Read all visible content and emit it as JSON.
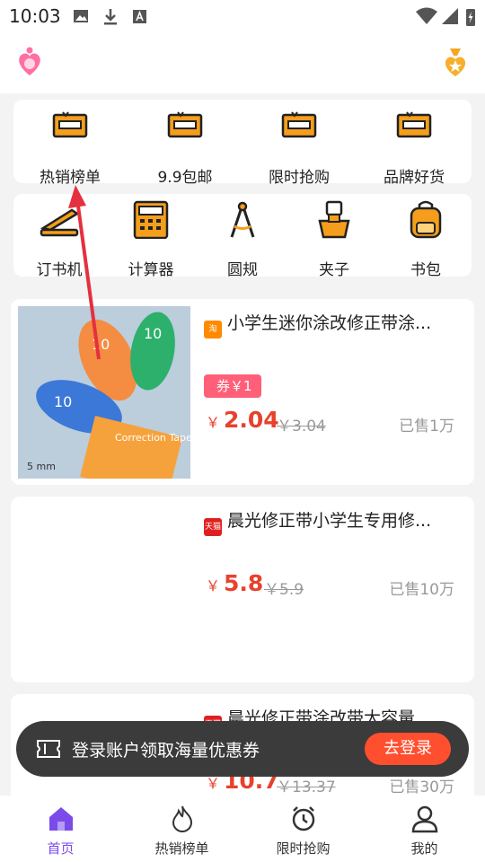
{
  "status_bar": {
    "time": "10:03"
  },
  "top_categories": [
    {
      "label": "热销榜单",
      "icon": "ticket-icon"
    },
    {
      "label": "9.9包邮",
      "icon": "ticket-icon"
    },
    {
      "label": "限时抢购",
      "icon": "ticket-icon"
    },
    {
      "label": "品牌好货",
      "icon": "ticket-icon"
    }
  ],
  "sub_categories": [
    {
      "label": "订书机",
      "icon": "stapler-icon"
    },
    {
      "label": "计算器",
      "icon": "calculator-icon"
    },
    {
      "label": "圆规",
      "icon": "compass-icon"
    },
    {
      "label": "夹子",
      "icon": "clip-icon"
    },
    {
      "label": "书包",
      "icon": "backpack-icon"
    }
  ],
  "products": [
    {
      "title": "小学生迷你涂改修正带涂...",
      "shop": "淘",
      "coupon": "券￥1",
      "yen": "￥",
      "price": "2.04",
      "orig_price": "￥3.04",
      "sold": "已售1万",
      "image_text": [
        "10",
        "10",
        "10",
        "Correction Tape",
        "5 mm"
      ]
    },
    {
      "title": "晨光修正带小学生专用修...",
      "shop": "天猫",
      "yen": "￥",
      "price": "5.8",
      "orig_price": "￥5.9",
      "sold": "已售10万"
    },
    {
      "title": "晨光修正带涂改带大容量...",
      "shop": "天猫",
      "yen": "￥",
      "price": "10.7",
      "orig_price": "￥13.37",
      "sold": "已售30万"
    }
  ],
  "toast": {
    "message": "登录账户领取海量优惠券",
    "button": "去登录"
  },
  "tabbar": [
    {
      "label": "首页",
      "icon": "home-icon",
      "active": true
    },
    {
      "label": "热销榜单",
      "icon": "flame-icon"
    },
    {
      "label": "限时抢购",
      "icon": "alarm-clock-icon"
    },
    {
      "label": "我的",
      "icon": "person-icon"
    }
  ],
  "colors": {
    "accent": "#e8412c",
    "active_tab": "#7b4bea",
    "icon_orange": "#f59e1c",
    "coupon": "#ff5f78"
  }
}
